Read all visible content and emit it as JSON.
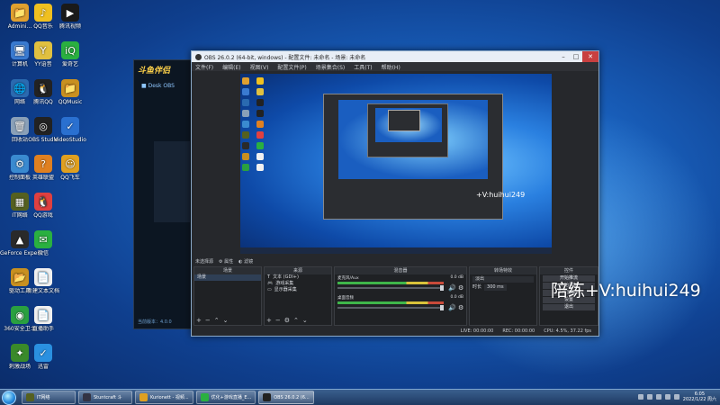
{
  "desktop": {
    "icons_col1": [
      {
        "label": "Admini...",
        "color": "#e0a030",
        "glyph": "📁"
      },
      {
        "label": "计算机",
        "color": "#3a7ad0",
        "glyph": "🖥"
      },
      {
        "label": "网络",
        "color": "#2a6ab0",
        "glyph": "🌐"
      },
      {
        "label": "回收站",
        "color": "#8aa0b8",
        "glyph": "🗑"
      },
      {
        "label": "控制面板",
        "color": "#3a8ad0",
        "glyph": "⚙"
      },
      {
        "label": "IT网络",
        "color": "#556020",
        "glyph": "▦"
      },
      {
        "label": "GeForce Experience",
        "color": "#2a2a2a",
        "glyph": "▲"
      },
      {
        "label": "驱动工具",
        "color": "#c89020",
        "glyph": "📂"
      },
      {
        "label": "360安全卫士",
        "color": "#2aa040",
        "glyph": "◉"
      },
      {
        "label": "刺激战场",
        "color": "#3a8a2a",
        "glyph": "✦"
      }
    ],
    "icons_col2": [
      {
        "label": "QQ音乐",
        "color": "#f0c020",
        "glyph": "♪"
      },
      {
        "label": "YY语音",
        "color": "#e0c040",
        "glyph": "Y"
      },
      {
        "label": "腾讯QQ",
        "color": "#222",
        "glyph": "🐧"
      },
      {
        "label": "OBS Studio",
        "color": "#222",
        "glyph": "◎"
      },
      {
        "label": "英雄联盟",
        "color": "#e08020",
        "glyph": "?"
      },
      {
        "label": "QQ游戏",
        "color": "#e04040",
        "glyph": "🐧"
      },
      {
        "label": "微信",
        "color": "#2ab040",
        "glyph": "✉"
      },
      {
        "label": "新建文本文档",
        "color": "#f0f0f0",
        "glyph": "📄"
      },
      {
        "label": "直播助手",
        "color": "#f0f0f0",
        "glyph": "📄"
      },
      {
        "label": "迅雷",
        "color": "#2a90e0",
        "glyph": "✓"
      }
    ],
    "icons_col3": [
      {
        "label": "腾讯视频",
        "color": "#1a1a1a",
        "glyph": "▶"
      },
      {
        "label": "爱奇艺",
        "color": "#2ab040",
        "glyph": "iQ"
      },
      {
        "label": "QQMusic",
        "color": "#c89020",
        "glyph": "📁"
      },
      {
        "label": "VideoStudio",
        "color": "#2a70d0",
        "glyph": "✓"
      },
      {
        "label": "QQ飞车",
        "color": "#e0a020",
        "glyph": "☺"
      }
    ]
  },
  "bg_app": {
    "logo": "斗鱼伴侣",
    "subtitle": "■ Desk OBS",
    "footer": "当前版本：4.0.0"
  },
  "obs": {
    "title": "OBS 26.0.2 (64-bit, windows) - 配置文件: 未命名 - 场景: 未命名",
    "menu": [
      "文件(F)",
      "编辑(E)",
      "视图(V)",
      "配置文件(P)",
      "场景集合(S)",
      "工具(T)",
      "帮助(H)"
    ],
    "preview_watermark": "+V:huihui249",
    "scene_bar": {
      "label": "未选择源",
      "props": "属性",
      "filters": "滤镜"
    },
    "docks": {
      "scenes": {
        "title": "场景",
        "items": [
          "场景"
        ]
      },
      "sources": {
        "title": "来源",
        "items": [
          "文本 (GDI+)",
          "游戏采集",
          "显示器采集"
        ]
      },
      "mixer": {
        "title": "混音器",
        "tracks": [
          {
            "name": "麦克风/Aux",
            "db": "0.0 dB"
          },
          {
            "name": "桌面音频",
            "db": "0.0 dB"
          }
        ]
      },
      "transitions": {
        "title": "转场特效",
        "type": "淡出",
        "duration_label": "时长",
        "duration": "300 ms"
      },
      "controls": {
        "title": "控件",
        "buttons": [
          "开始推流",
          "开始录制",
          "工作室模式",
          "设置",
          "退出"
        ]
      }
    },
    "status": {
      "live": "LIVE: 00:00:00",
      "rec": "REC: 00:00:00",
      "cpu": "CPU: 4.5%, 37.22 fps"
    }
  },
  "watermark": "陪练+V:huihui249",
  "taskbar": {
    "items": [
      {
        "label": "IT网络",
        "color": "#556020",
        "active": false
      },
      {
        "label": "Stuntcraft 斗",
        "color": "#334",
        "active": false
      },
      {
        "label": "Kurionett - 视频...",
        "color": "#e0a020",
        "active": false
      },
      {
        "label": "优化+游戏直播_E...",
        "color": "#2ab040",
        "active": false
      },
      {
        "label": "OBS 26.0.2 (6...",
        "color": "#222",
        "active": true
      }
    ],
    "clock_time": "6:05",
    "clock_date": "2022/1/22 周六"
  }
}
